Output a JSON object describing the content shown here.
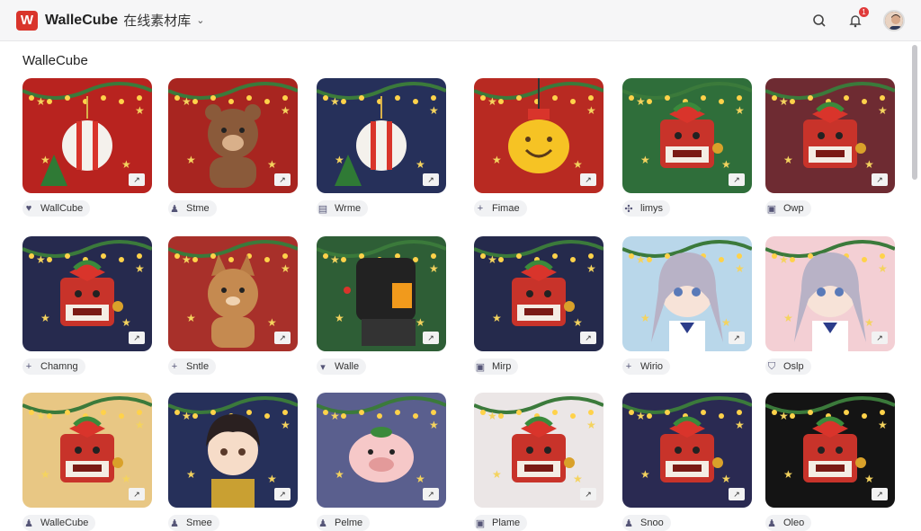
{
  "header": {
    "logo_letter": "W",
    "title": "WalleCube",
    "subtitle": "在线素材库",
    "notification_count": "1"
  },
  "section": {
    "title": "WalleCube"
  },
  "cards": [
    {
      "label": "WallCube",
      "icon": "heart-icon",
      "bg": "#b8231f",
      "motif": "ornament"
    },
    {
      "label": "Stme",
      "icon": "person-icon",
      "bg": "#a82520",
      "motif": "bear"
    },
    {
      "label": "Wrme",
      "icon": "doc-icon",
      "bg": "#26305a",
      "motif": "ornament"
    },
    {
      "label": "Fimae",
      "icon": "plus-icon",
      "bg": "#b82a22",
      "motif": "smile"
    },
    {
      "label": "limys",
      "icon": "gear-icon",
      "bg": "#2f6e3a",
      "motif": "robot"
    },
    {
      "label": "Owp",
      "icon": "frame-icon",
      "bg": "#6e2b32",
      "motif": "robot"
    },
    {
      "label": "Chamng",
      "icon": "plus-icon",
      "bg": "#262a4e",
      "motif": "robot"
    },
    {
      "label": "Sntle",
      "icon": "plus-icon",
      "bg": "#a8302a",
      "motif": "cat"
    },
    {
      "label": "Walle",
      "icon": "cup-icon",
      "bg": "#2e5e36",
      "motif": "mech"
    },
    {
      "label": "Mirp",
      "icon": "frame-icon",
      "bg": "#252a4c",
      "motif": "robot"
    },
    {
      "label": "Wirio",
      "icon": "plus-icon",
      "bg": "#b9d7ea",
      "motif": "girl"
    },
    {
      "label": "Oslp",
      "icon": "shield-icon",
      "bg": "#f3cfd4",
      "motif": "girl"
    },
    {
      "label": "WalleCube",
      "icon": "person-icon",
      "bg": "#e8c784",
      "motif": "robot"
    },
    {
      "label": "Smee",
      "icon": "person-icon",
      "bg": "#26305a",
      "motif": "boy"
    },
    {
      "label": "Pelme",
      "icon": "person-icon",
      "bg": "#5a5f8e",
      "motif": "pig"
    },
    {
      "label": "Plame",
      "icon": "frame-icon",
      "bg": "#ebe6e6",
      "motif": "robot"
    },
    {
      "label": "Snoo",
      "icon": "person-icon",
      "bg": "#2a2a52",
      "motif": "robot"
    },
    {
      "label": "Oleo",
      "icon": "person-icon",
      "bg": "#141414",
      "motif": "robot"
    }
  ],
  "colors": {
    "brand": "#d9342b",
    "badge": "#e03a3a"
  }
}
